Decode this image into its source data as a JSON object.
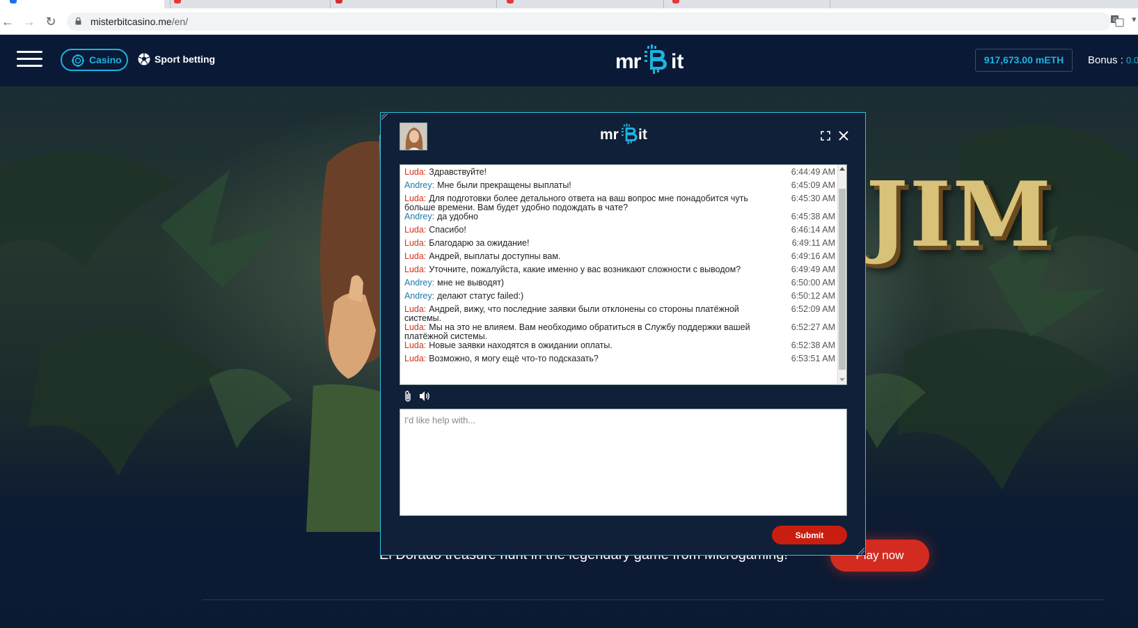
{
  "browser": {
    "url_host": "misterbitcasino.me",
    "url_path": "/en/"
  },
  "header": {
    "casino_label": "Casino",
    "sport_label": "Sport betting",
    "logo_mr": "mr",
    "logo_it": "it",
    "balance": "917,673.00 mETH",
    "bonus_label": "Bonus :",
    "bonus_value": "0.0"
  },
  "hero": {
    "title": "JIM",
    "tagline": "El Dorado treasure hunt in the legendary game from Microgaming!",
    "play_label": "Play now"
  },
  "chat": {
    "logo_mr": "mr",
    "logo_it": "it",
    "messages": [
      {
        "who": "Luda:",
        "text": "Здравствуйте!",
        "time": "6:44:49 AM",
        "role": "luda"
      },
      {
        "who": "Andrey:",
        "text": "Мне были прекращены выплаты!",
        "time": "6:45:09 AM",
        "role": "andrey"
      },
      {
        "who": "Luda:",
        "text": "Для подготовки более детального ответа на ваш вопрос мне понадобится чуть больше времени. Вам будет удобно подождать в чате?",
        "time": "6:45:30 AM",
        "role": "luda"
      },
      {
        "who": "Andrey:",
        "text": "да удобно",
        "time": "6:45:38 AM",
        "role": "andrey"
      },
      {
        "who": "Luda:",
        "text": "Спасибо!",
        "time": "6:46:14 AM",
        "role": "luda"
      },
      {
        "who": "Luda:",
        "text": "Благодарю за ожидание!",
        "time": "6:49:11 AM",
        "role": "luda"
      },
      {
        "who": "Luda:",
        "text": "Андрей, выплаты доступны вам.",
        "time": "6:49:16 AM",
        "role": "luda"
      },
      {
        "who": "Luda:",
        "text": "Уточните, пожалуйста, какие именно у вас возникают сложности с выводом?",
        "time": "6:49:49 AM",
        "role": "luda"
      },
      {
        "who": "Andrey:",
        "text": "мне не выводят)",
        "time": "6:50:00 AM",
        "role": "andrey"
      },
      {
        "who": "Andrey:",
        "text": "делают статус failed:)",
        "time": "6:50:12 AM",
        "role": "andrey"
      },
      {
        "who": "Luda:",
        "text": "Андрей, вижу, что последние заявки были отклонены со стороны платёжной системы.",
        "time": "6:52:09 AM",
        "role": "luda"
      },
      {
        "who": "Luda:",
        "text": "Мы на это не влияем. Вам необходимо обратиться в Службу поддержки вашей платёжной системы.",
        "time": "6:52:27 AM",
        "role": "luda"
      },
      {
        "who": "Luda:",
        "text": "Новые заявки находятся в ожидании оплаты.",
        "time": "6:52:38 AM",
        "role": "luda"
      },
      {
        "who": "Luda:",
        "text": "Возможно, я могу ещё что-то подсказать?",
        "time": "6:53:51 AM",
        "role": "luda"
      }
    ],
    "compose_placeholder": "I'd like help with...",
    "submit_label": "Submit"
  },
  "colors": {
    "accent": "#1db3e0",
    "play_button": "#d42b20",
    "submit_button": "#c91d10",
    "agent_name": "#d0321a",
    "user_name": "#1d7aa8"
  }
}
